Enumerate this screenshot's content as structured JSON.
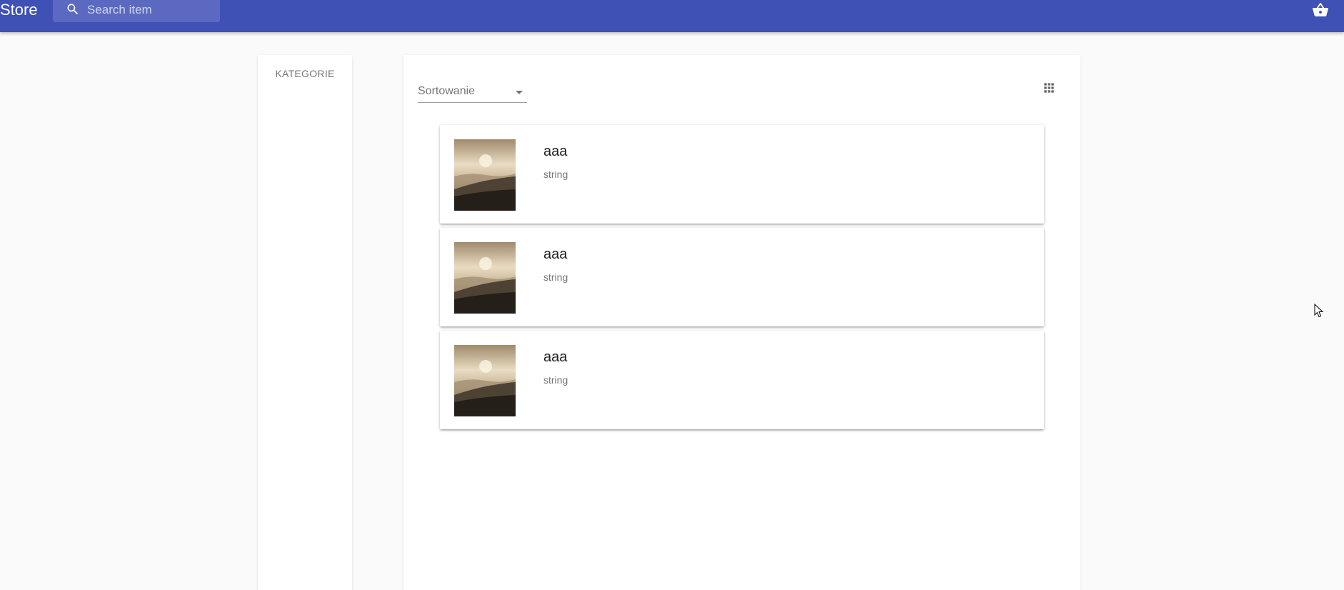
{
  "appbar": {
    "brand": "Store",
    "search_placeholder": "Search item",
    "search_value": "",
    "icons": {
      "search": "search-icon",
      "cart": "shopping-basket-icon"
    },
    "color": "#3f51b5"
  },
  "sidebar": {
    "title": "KATEGORIE"
  },
  "toolbar": {
    "sort_label": "Sortowanie",
    "view_toggle_icon": "apps-grid-icon"
  },
  "items": [
    {
      "title": "aaa",
      "subtitle": "string",
      "image": "mountain-sunset-photo"
    },
    {
      "title": "aaa",
      "subtitle": "string",
      "image": "mountain-sunset-photo"
    },
    {
      "title": "aaa",
      "subtitle": "string",
      "image": "mountain-sunset-photo"
    }
  ]
}
